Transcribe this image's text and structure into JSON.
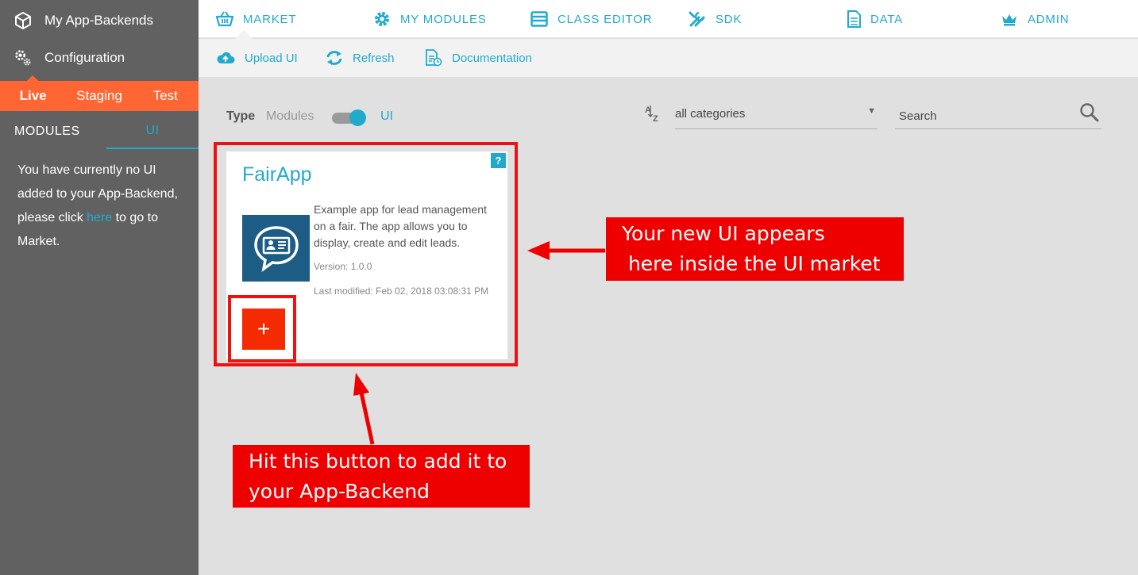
{
  "sidebar": {
    "app_backends_label": "My App-Backends",
    "configuration_label": "Configuration",
    "env_tabs": [
      {
        "label": "Live"
      },
      {
        "label": "Staging"
      },
      {
        "label": "Test"
      }
    ],
    "module_tabs": [
      {
        "label": "MODULES"
      },
      {
        "label": "UI"
      }
    ],
    "message_part1": "You have currently no UI added to your App-Backend, please click ",
    "message_link": "here",
    "message_part2": " to go to Market."
  },
  "topnav": {
    "items": [
      {
        "label": "MARKET",
        "icon": "basket-icon"
      },
      {
        "label": "MY MODULES",
        "icon": "gear-icon"
      },
      {
        "label": "CLASS EDITOR",
        "icon": "window-icon"
      },
      {
        "label": "SDK",
        "icon": "tools-icon"
      },
      {
        "label": "DATA",
        "icon": "document-icon"
      },
      {
        "label": "ADMIN",
        "icon": "crown-icon"
      }
    ]
  },
  "subnav": {
    "upload_label": "Upload UI",
    "refresh_label": "Refresh",
    "documentation_label": "Documentation"
  },
  "filters": {
    "type_label": "Type",
    "modules_label": "Modules",
    "ui_label": "UI",
    "toggle_state": "UI",
    "category_value": "all categories",
    "category_arrow": "▼",
    "search_placeholder": "Search"
  },
  "card": {
    "title": "FairApp",
    "help": "?",
    "description": "Example app for lead management on a fair. The app allows you to display, create and edit leads.",
    "version": "Version: 1.0.0",
    "last_modified": "Last modified: Feb 02, 2018 03:08:31 PM",
    "add_label": "+"
  },
  "annotations": {
    "callout1_line1": "Your new UI appears",
    "callout1_line2": " here inside the UI market",
    "callout2_line1": "Hit this button to add it to",
    "callout2_line2": "your App-Backend"
  },
  "colors": {
    "accent": "#22aacc",
    "sidebar_bg": "#616161",
    "env_bar": "#ff6633",
    "add_button": "#f42a00",
    "annotation_red": "#ee0000",
    "thumb_bg": "#1c5c85"
  }
}
